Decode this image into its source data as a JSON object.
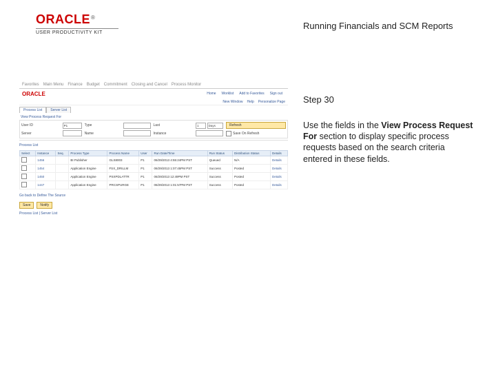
{
  "logo": {
    "brand": "ORACLE",
    "tm": "®",
    "sub": "USER PRODUCTIVITY KIT"
  },
  "doc": {
    "title": "Running Financials and SCM Reports"
  },
  "step": {
    "label": "Step 30"
  },
  "instruction": {
    "pre": "Use the fields in the ",
    "bold": "View Process Request For",
    "post": " section to display specific process requests based on the search criteria entered in these fields."
  },
  "shot": {
    "topbar": [
      "Favorites",
      "Main Menu",
      "Finance",
      "Budget",
      "Commitment",
      "Closing and Cancel",
      "Process Monitor"
    ],
    "menu": [
      "Home",
      "Worklist",
      "Add to Favorites",
      "Sign out"
    ],
    "sub": [
      "New Window",
      "Help",
      "Personalize Page"
    ],
    "tabs": [
      "Process List",
      "Server List"
    ],
    "panelTitle": "View Process Request For",
    "form": {
      "userLbl": "User ID",
      "user": "P1",
      "typeLbl": "Type",
      "type": "",
      "lastLbl": "Last",
      "lastN": "1",
      "lastUnit": "Days",
      "refresh": "Refresh",
      "serverLbl": "Server",
      "server": "",
      "nameLbl": "Name",
      "name": "",
      "instLbl": "Instance",
      "inst": "",
      "saveChk": "Save On Refresh"
    },
    "plTitle": "Process List",
    "headers": [
      "Select",
      "Instance",
      "Seq.",
      "Process Type",
      "Process Name",
      "User",
      "Run Date/Time",
      "Run Status",
      "Distribution Status",
      "Details"
    ],
    "rows": [
      [
        "",
        "1456",
        "",
        "BI Publisher",
        "GLS8003",
        "P1",
        "06/29/2013  4:55:24PM PST",
        "Queued",
        "N/A",
        "Details"
      ],
      [
        "",
        "1454",
        "",
        "Application Engine",
        "FSX_DRILLM",
        "P1",
        "06/29/2013  1:07:45PM PST",
        "Success",
        "Posted",
        "Details"
      ],
      [
        "",
        "1450",
        "",
        "Application Engine",
        "PSXPDLATTR",
        "P1",
        "06/29/2013  12:49PM PST",
        "Success",
        "Posted",
        "Details"
      ],
      [
        "",
        "1447",
        "",
        "Application Engine",
        "PRCSPURGE",
        "P1",
        "06/29/2013  1:01:57PM PST",
        "Success",
        "Posted",
        "Details"
      ]
    ],
    "sched": "Go back to Define The Source",
    "btns": [
      "Save",
      "Notify"
    ],
    "footerTabs": "Process List | Server List"
  }
}
